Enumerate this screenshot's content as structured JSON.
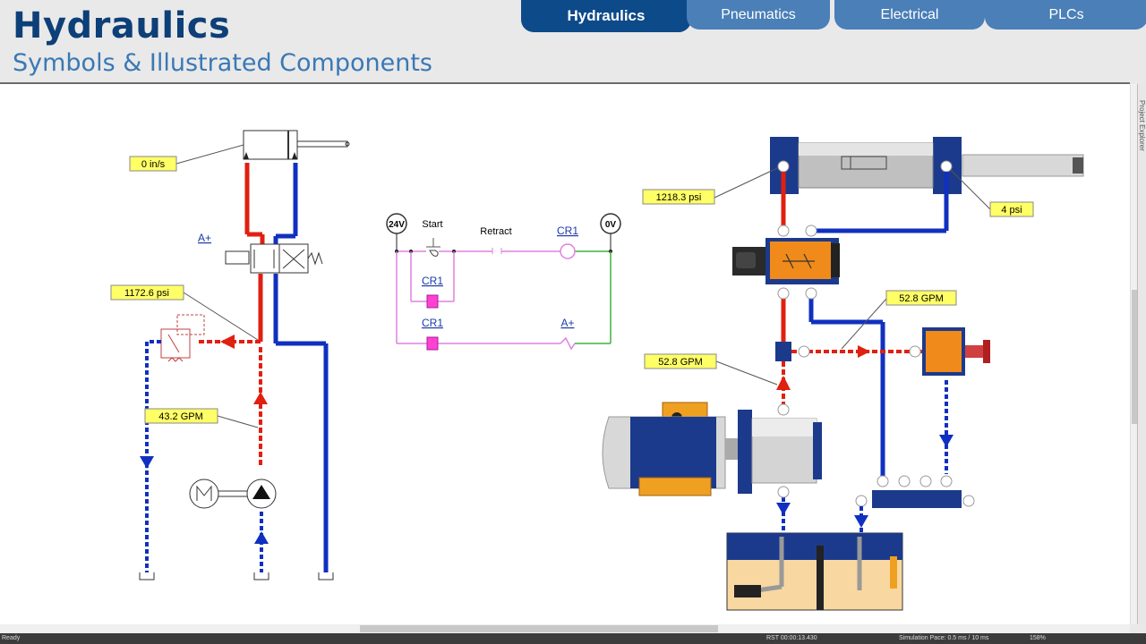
{
  "header": {
    "title": "Hydraulics",
    "subtitle": "Symbols & Illustrated Components"
  },
  "tabs": [
    {
      "label": "Hydraulics",
      "active": true
    },
    {
      "label": "Pneumatics",
      "active": false
    },
    {
      "label": "Electrical",
      "active": false
    },
    {
      "label": "PLCs",
      "active": false
    }
  ],
  "schematic": {
    "cylinder_speed": "0 in/s",
    "solenoid_label": "A+",
    "relief_pressure": "1172.6 psi",
    "pump_flow": "43.2 GPM"
  },
  "ladder": {
    "rail_left": "24V",
    "rail_right": "0V",
    "start_label": "Start",
    "retract_label": "Retract",
    "coil_cr1": "CR1",
    "contact_cr1_a": "CR1",
    "contact_cr1_b": "CR1",
    "output_label": "A+"
  },
  "illustrated": {
    "cap_pressure": "1218.3 psi",
    "rod_pressure": "4 psi",
    "return_flow": "52.8 GPM",
    "supply_flow": "52.8 GPM"
  },
  "side_panel": {
    "label": "Project Explorer"
  },
  "status": {
    "ready": "Ready",
    "time": "RST 00:00:13.430",
    "sim_pace": "Simulation Pace: 0.5 ms / 10 ms",
    "zoom": "158%"
  },
  "colors": {
    "pressure": "#e02010",
    "tank": "#1030c0",
    "ladder": "#e080e0",
    "ladder_green": "#40b040",
    "label_bg": "#ffff66",
    "header_dark": "#0d3f78",
    "tab_active": "#0d4a8a",
    "tab_inactive": "#4a7fb7"
  }
}
